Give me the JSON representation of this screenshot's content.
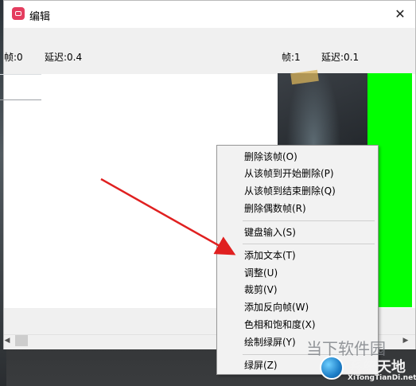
{
  "window": {
    "title": "编辑",
    "close_symbol": "✕"
  },
  "frames": [
    {
      "frame_label": "帧:0",
      "delay_label": "延迟:0.4"
    },
    {
      "frame_label": "帧:1",
      "delay_label": "延迟:0.1"
    }
  ],
  "context_menu": {
    "items": [
      "删除该帧(O)",
      "从该帧到开始删除(P)",
      "从该帧到结束删除(Q)",
      "删除偶数帧(R)",
      "键盘输入(S)",
      "添加文本(T)",
      "调整(U)",
      "裁剪(V)",
      "添加反向帧(W)",
      "色相和饱和度(X)",
      "绘制绿屏(Y)",
      "绿屏(Z)"
    ]
  },
  "scrollbar": {
    "left_symbol": "◀",
    "right_symbol": "▶"
  },
  "colors": {
    "green_frame": "#00ff00",
    "annotation_arrow": "#e02020",
    "app_icon": "#e43d5f"
  },
  "watermark": {
    "left_text": "当下软件园",
    "brand": "系统天地",
    "url": "XiTongTianDi.net"
  }
}
